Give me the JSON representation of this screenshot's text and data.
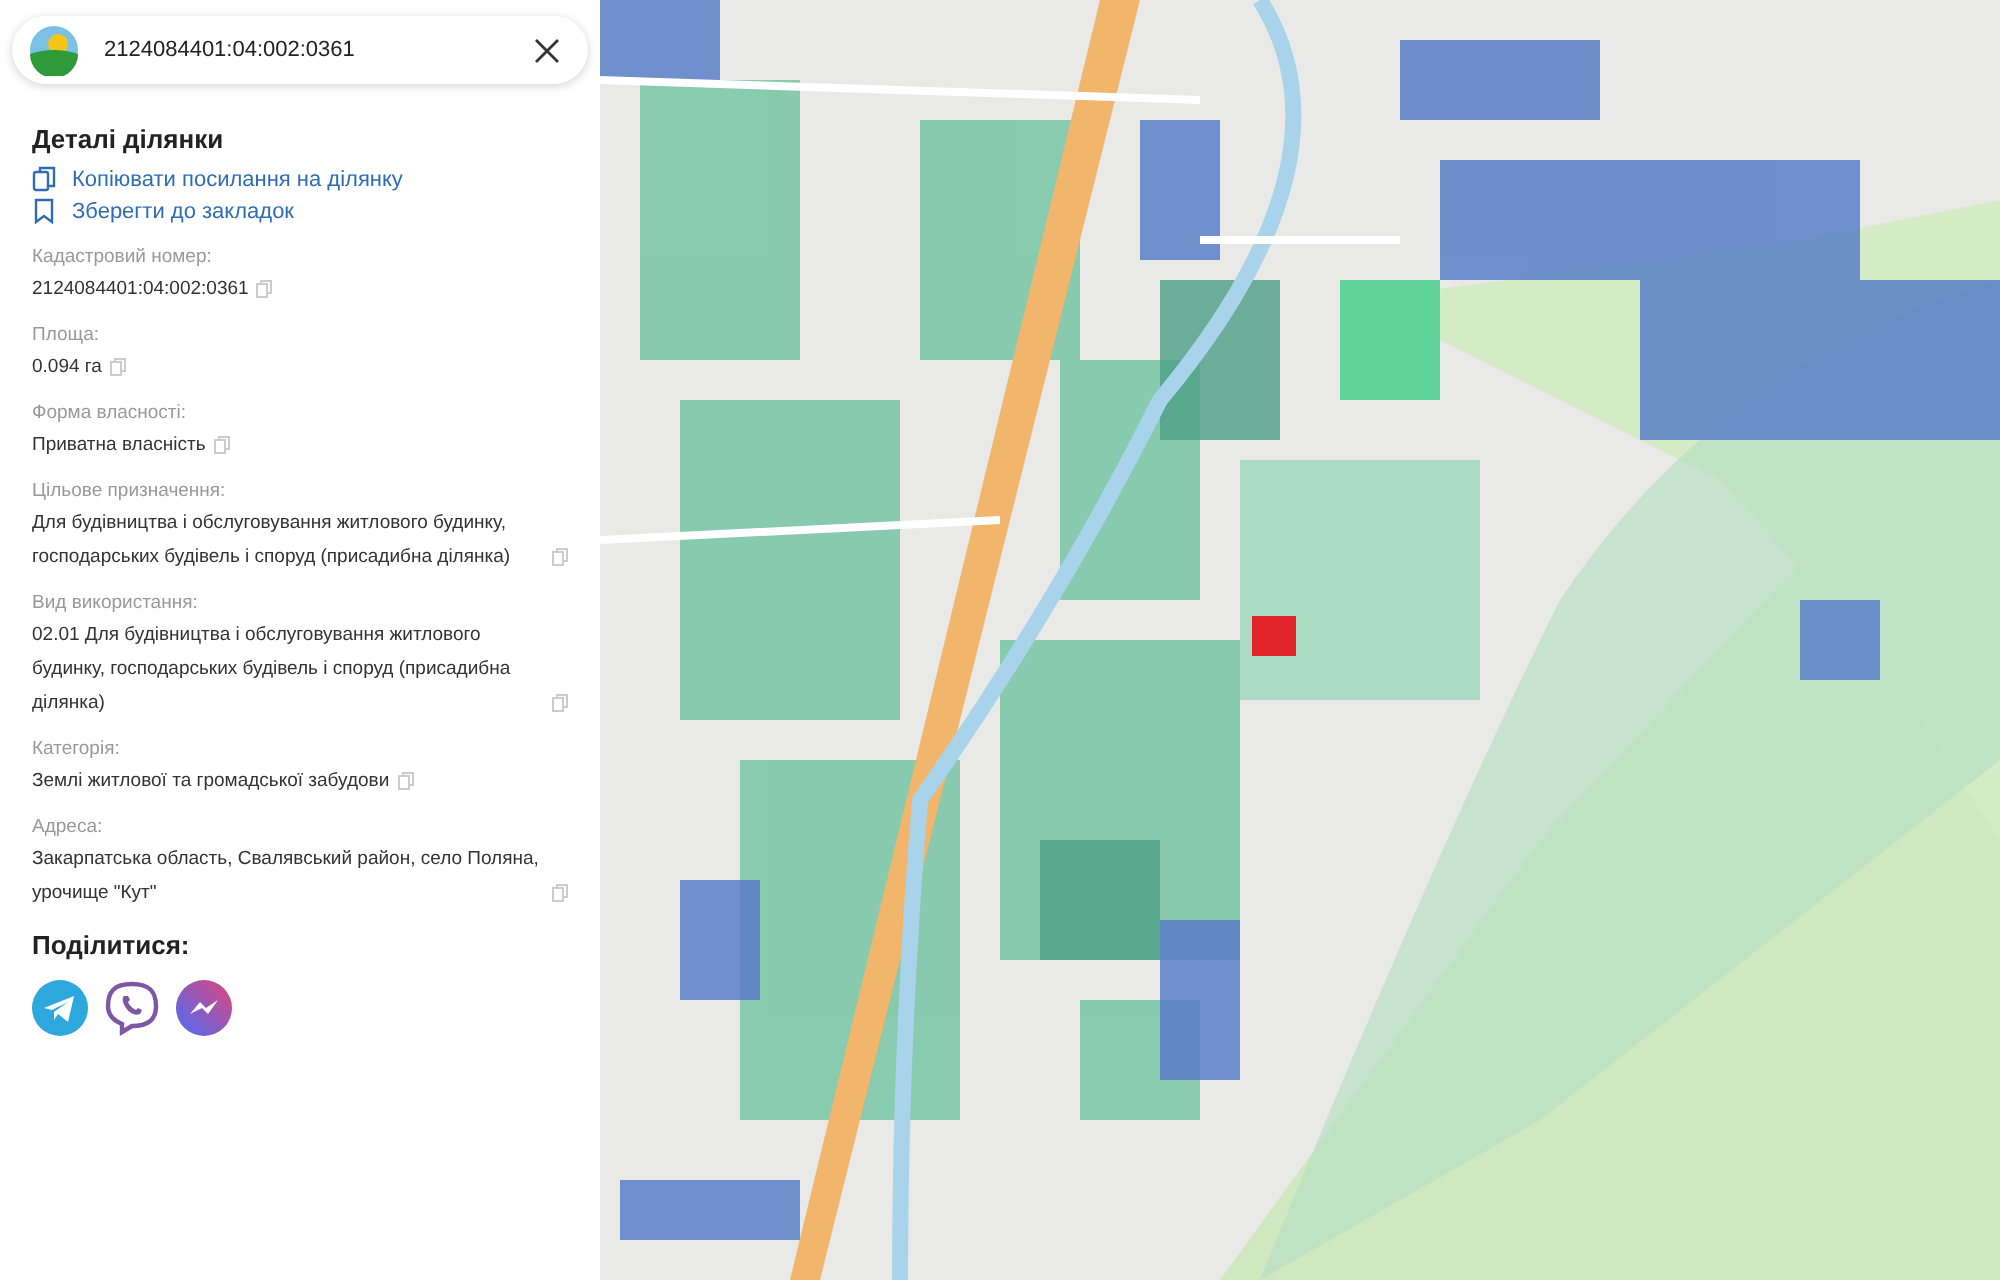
{
  "search": {
    "value": "2124084401:04:002:0361"
  },
  "details": {
    "title": "Деталі ділянки",
    "actions": [
      {
        "kind": "copy",
        "label": "Копіювати посилання на ділянку"
      },
      {
        "kind": "bookmark",
        "label": "Зберегти до закладок"
      }
    ],
    "fields": [
      {
        "label": "Кадастровий номер:",
        "value": "2124084401:04:002:0361"
      },
      {
        "label": "Площа:",
        "value": "0.094 га"
      },
      {
        "label": "Форма власності:",
        "value": "Приватна власність"
      },
      {
        "label": "Цільове призначення:",
        "value": "Для будівництва і обслуговування житлового будинку, господарських будівель і споруд (присадибна ділянка)"
      },
      {
        "label": "Вид використання:",
        "value": "02.01 Для будівництва і обслуговування житлового будинку, господарських будівель і споруд (присадибна ділянка)"
      },
      {
        "label": "Категорія:",
        "value": "Землі житлової та громадської забудови"
      },
      {
        "label": "Адреса:",
        "value": "Закарпатська область, Свалявський район, село Поляна, урочище \"Кут\""
      }
    ]
  },
  "share": {
    "title": "Поділитися:",
    "networks": [
      {
        "kind": "telegram"
      },
      {
        "kind": "viber"
      },
      {
        "kind": "messenger"
      }
    ]
  }
}
